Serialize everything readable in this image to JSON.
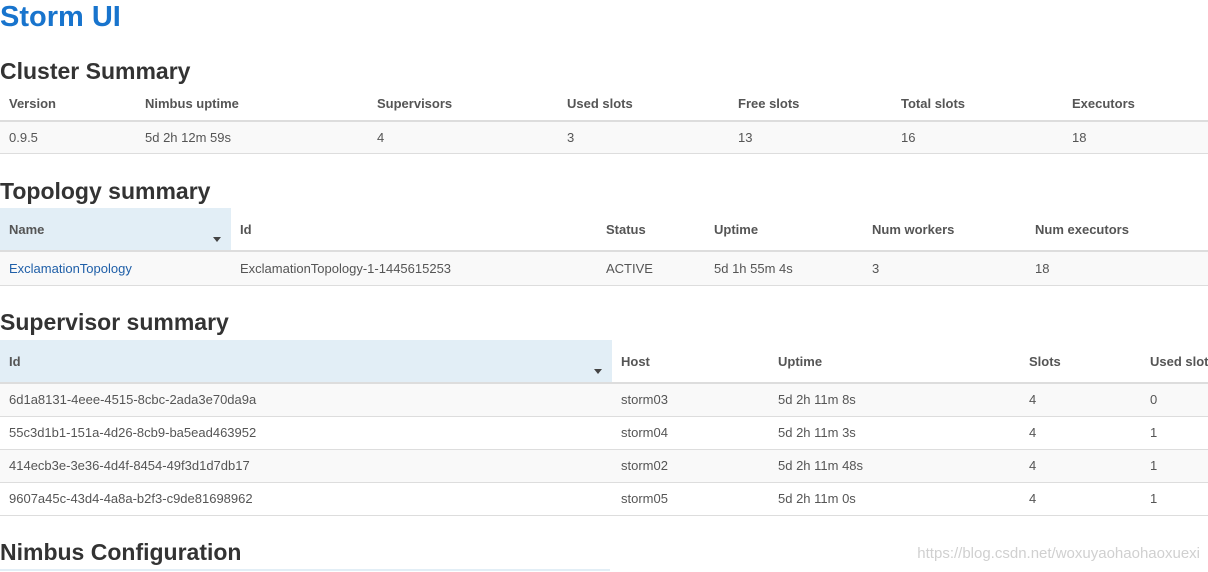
{
  "app": {
    "title": "Storm UI"
  },
  "cluster": {
    "title": "Cluster Summary",
    "headers": [
      "Version",
      "Nimbus uptime",
      "Supervisors",
      "Used slots",
      "Free slots",
      "Total slots",
      "Executors"
    ],
    "row": [
      "0.9.5",
      "5d 2h 12m 59s",
      "4",
      "3",
      "13",
      "16",
      "18"
    ]
  },
  "topology": {
    "title": "Topology summary",
    "headers": [
      "Name",
      "Id",
      "Status",
      "Uptime",
      "Num workers",
      "Num executors"
    ],
    "row": [
      "ExclamationTopology",
      "ExclamationTopology-1-1445615253",
      "ACTIVE",
      "5d 1h 55m 4s",
      "3",
      "18"
    ]
  },
  "supervisor": {
    "title": "Supervisor summary",
    "headers": [
      "Id",
      "Host",
      "Uptime",
      "Slots",
      "Used slots"
    ],
    "rows": [
      [
        "6d1a8131-4eee-4515-8cbc-2ada3e70da9a",
        "storm03",
        "5d 2h 11m 8s",
        "4",
        "0"
      ],
      [
        "55c3d1b1-151a-4d26-8cb9-ba5ead463952",
        "storm04",
        "5d 2h 11m 3s",
        "4",
        "1"
      ],
      [
        "414ecb3e-3e36-4d4f-8454-49f3d1d7db17",
        "storm02",
        "5d 2h 11m 48s",
        "4",
        "1"
      ],
      [
        "9607a45c-43d4-4a8a-b2f3-c9de81698962",
        "storm05",
        "5d 2h 11m 0s",
        "4",
        "1"
      ]
    ]
  },
  "nimbus": {
    "title": "Nimbus Configuration"
  },
  "watermark": "https://blog.csdn.net/woxuyaohaohaoxuexi"
}
